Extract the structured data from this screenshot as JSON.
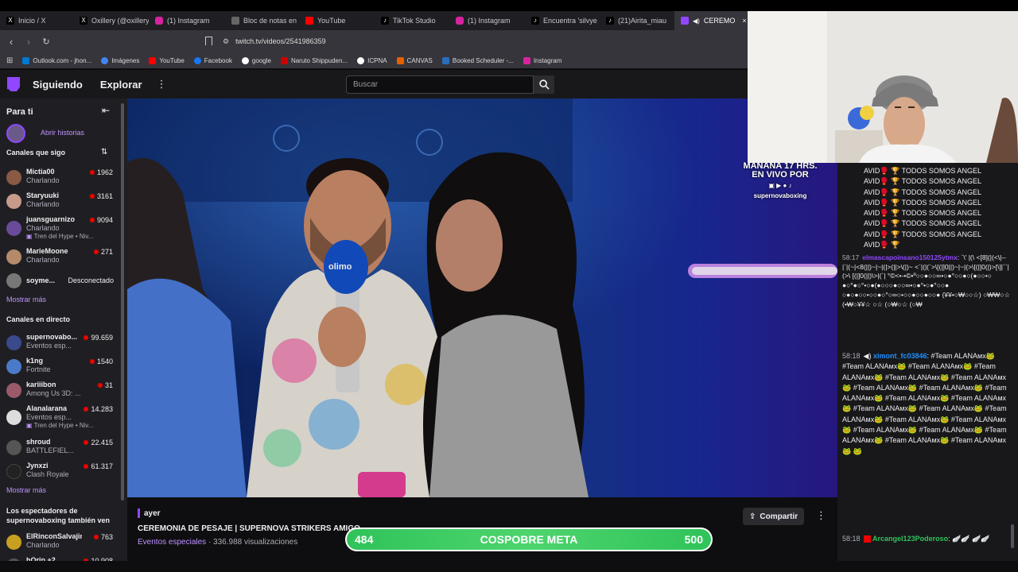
{
  "browser": {
    "tabs": [
      {
        "label": "Inicio / X",
        "color": "#000000"
      },
      {
        "label": "Oxillery (@oxillery",
        "color": "#000000"
      },
      {
        "label": "(1) Instagram",
        "color": "#d6249f"
      },
      {
        "label": "Bloc de notas en",
        "color": "#555555"
      },
      {
        "label": "YouTube",
        "color": "#ff0000"
      },
      {
        "label": "TikTok Studio",
        "color": "#111111"
      },
      {
        "label": "(1) Instagram",
        "color": "#d6249f"
      },
      {
        "label": "Encuentra 'silvye",
        "color": "#111111"
      },
      {
        "label": "(21)Airita_miau",
        "color": "#111111"
      },
      {
        "label": "CEREMO",
        "color": "#9147ff"
      }
    ],
    "url": "twitch.tv/videos/2541986359",
    "bookmarks": [
      {
        "label": "Outlook.com - jhon...",
        "color": "#0078d4"
      },
      {
        "label": "Imágenes",
        "color": "#4285f4"
      },
      {
        "label": "YouTube",
        "color": "#ff0000"
      },
      {
        "label": "Facebook",
        "color": "#1877f2"
      },
      {
        "label": "google",
        "color": "#ffffff"
      },
      {
        "label": "Naruto Shippuden...",
        "color": "#cc0000"
      },
      {
        "label": "ICPNA",
        "color": "#ffffff"
      },
      {
        "label": "CANVAS",
        "color": "#e66000"
      },
      {
        "label": "Booked Scheduler -...",
        "color": "#2a6ebb"
      },
      {
        "label": "Instagram",
        "color": "#d6249f"
      }
    ]
  },
  "twitch": {
    "nav_following": "Siguiendo",
    "nav_explore": "Explorar",
    "search_placeholder": "Buscar",
    "sidebar": {
      "for_you": "Para ti",
      "stories": "Abrir historias",
      "followed_header": "Canales que sigo",
      "followed": [
        {
          "name": "Mictia00",
          "game": "Charlando",
          "viewers": "1962",
          "color": "#8a5a44"
        },
        {
          "name": "Staryuuki",
          "game": "Charlando",
          "viewers": "3161",
          "color": "#c79a8a"
        },
        {
          "name": "juansguarnizo",
          "game": "Charlando",
          "viewers": "9094",
          "color": "#6a4b9a",
          "hype": "Tren del Hype • Niv..."
        },
        {
          "name": "MarieMoone",
          "game": "Charlando",
          "viewers": "271",
          "color": "#b58a6a"
        },
        {
          "name": "soyme...",
          "game": "",
          "viewers": "Desconectado",
          "color": "#777777",
          "offline": true
        }
      ],
      "show_more": "Mostrar más",
      "live_header": "Canales en directo",
      "live": [
        {
          "name": "supernovabo...",
          "game": "Eventos esp...",
          "viewers": "99.659",
          "color": "#3a4a8a"
        },
        {
          "name": "k1ng",
          "game": "Fortnite",
          "viewers": "1540",
          "color": "#4a7ac8"
        },
        {
          "name": "kariiibon",
          "game": "Among Us 3D: ...",
          "viewers": "31",
          "color": "#9a5a6a"
        },
        {
          "name": "Alanalarana",
          "game": "Eventos esp...",
          "viewers": "14.283",
          "color": "#dddddd",
          "hype": "Tren del Hype • Niv..."
        },
        {
          "name": "shroud",
          "game": "BATTLEFIEL...",
          "viewers": "22.415",
          "color": "#555555"
        },
        {
          "name": "Jynxzi",
          "game": "Clash Royale",
          "viewers": "61.317",
          "color": "#222222"
        }
      ],
      "show_more2": "Mostrar más",
      "also_header_1": "Los espectadores de",
      "also_header_2": "supernovaboxing también ven",
      "also": [
        {
          "name": "ElRinconSalvajin",
          "game": "Charlando",
          "viewers": "763",
          "color": "#c8a020"
        },
        {
          "name": "hOrip +2",
          "game": "",
          "viewers": "10.908",
          "color": "#555555"
        }
      ]
    },
    "video": {
      "overlay_line1": "MAÑANA 17 HRS.",
      "overlay_line2": "EN VIVO POR",
      "overlay_handle": "supernovaboxing",
      "mic_text": "olimo"
    },
    "info": {
      "date": "ayer",
      "title": "CEREMONIA DE PESAJE | SUPERNOVA STRIKERS AMIGO",
      "category": "Eventos especiales",
      "views": "· 336.988 visualizaciones",
      "share": "Compartir"
    },
    "goal": {
      "current": "484",
      "label": "COSPOBRE META",
      "target": "500",
      "progress": 0.968
    },
    "chat": [
      {
        "text": "AVID🥊 🏆 TODOS SOMOS ANGEL"
      },
      {
        "text": "AVID🥊 🏆 TODOS SOMOS ANGEL"
      },
      {
        "text": "AVID🥊 🏆 TODOS SOMOS ANGEL"
      },
      {
        "text": "AVID🥊 🏆 TODOS SOMOS ANGEL"
      },
      {
        "text": "AVID🥊 🏆 TODOS SOMOS ANGEL"
      },
      {
        "text": "AVID🥊 🏆 TODOS SOMOS ANGEL"
      },
      {
        "text": "AVID🥊 🏆 TODOS SOMOS ANGEL"
      },
      {
        "text": "AVID🥊 🏆"
      },
      {
        "time": "58:17",
        "user": "elmascapoinsano150125ytmx",
        "user_color": "#9147ff",
        "text": ": `\\' |(\\ <[8](|(<\\|--|`|(~|<8(||)~|~|(|>(||>\\(|)~ <`|(|(`>\\[(|]0||)~|~|(>\\[(|]0(|)>[\\]|``|(>\\ [(|]0(||)\\>|(`| °©<•-•©•º○○●○○∞•○●°○○●○(●○○•○ ●○°●○°•○●(●○○○●○○∞•○●°•○●°○○● ○●○●○○•○○●○°○∞○•○○●○○●○○● (¥¥•○₩○○☆) ○₩₩○☆ (•₩○¥¥☆ ○☆ (○₩○☆ (○₩"
      },
      {
        "time": "58:18",
        "user": "ximont_fc03846",
        "user_color": "#1e90ff",
        "text": ": #Team ALANAмх🐸 #Team ALANAмх🐸 #Team ALANAмх🐸 #Team ALANAмх🐸 #Team ALANAмх🐸 #Team ALANAмх🐸 #Team ALANAмх🐸 #Team ALANAмх🐸 #Team ALANAмх🐸 #Team ALANAмх🐸 #Team ALANAмх🐸 #Team ALANAмх🐸 #Team ALANAмх🐸 #Team ALANAмх🐸 #Team ALANAмх🐸 #Team ALANAмх🐸 #Team ALANAмх🐸 #Team ALANAмх🐸 #Team ALANAмх🐸 #Team ALANAмх🐸 #Team ALANAмх🐸 🐸"
      },
      {
        "time": "58:18",
        "user": "Arcangel123Poderoso",
        "user_color": "#2fc35a",
        "text": ": 🪽🪽 🪽🪽"
      }
    ]
  }
}
